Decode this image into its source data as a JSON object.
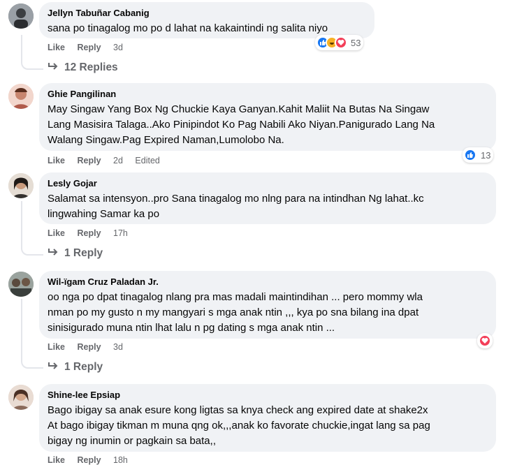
{
  "comments": [
    {
      "author": "Jellyn Tabuñar Cabanig",
      "text": "sana po tinagalog mo po d lahat na kakaintindi ng salita niyo",
      "like": "Like",
      "reply": "Reply",
      "time": "3d",
      "reaction_count": "53",
      "reaction_icons": [
        "like-icon",
        "haha-icon",
        "love-icon"
      ],
      "replies": "12 Replies"
    },
    {
      "author": "Ghie Pangilinan",
      "text": "May Singaw Yang Box Ng Chuckie Kaya Ganyan.Kahit Maliit Na Butas Na Singaw\nLang Masisira Talaga..Ako Pinipindot Ko Pag Nabili Ako Niyan.Panigurado Lang Na\nWalang Singaw.Pag Expired Naman,Lumolobo Na.",
      "like": "Like",
      "reply": "Reply",
      "time": "2d",
      "edited": "Edited",
      "reaction_count": "13",
      "reaction_icons": [
        "like-icon"
      ]
    },
    {
      "author": "Lesly Gojar",
      "text": "Salamat sa intensyon..pro Sana tinagalog mo nlng para na intindhan Ng lahat..kc\nlingwahing Samar ka po",
      "like": "Like",
      "reply": "Reply",
      "time": "17h",
      "replies": "1 Reply"
    },
    {
      "author": "Wil-ïgam Cruz Paladan Jr.",
      "text": "oo nga po dpat tinagalog nlang pra mas madali maintindihan ... pero mommy wla\nnman po my gusto n my mangyari s mga anak ntin ,,, kya po sna bilang ina dpat\nsinisigurado muna ntin lhat lalu n pg dating s mga anak ntin ...",
      "like": "Like",
      "reply": "Reply",
      "time": "3d",
      "reaction_icons": [
        "love-icon"
      ],
      "replies": "1 Reply"
    },
    {
      "author": "Shine-lee Epsiap",
      "text": "Bago ibigay sa anak esure kong ligtas sa knya check ang expired date at shake2x\nAt bago ibigay tikman m muna qng ok,,,anak ko favorate chuckie,ingat lang sa pag\nbigay ng inumin or pagkain sa bata,,",
      "like": "Like",
      "reply": "Reply",
      "time": "18h"
    }
  ],
  "colors": {
    "bubble": "#f0f2f5",
    "meta": "#65676b",
    "like": "#1877f2",
    "love": "#f33e58",
    "haha": "#f7b125"
  }
}
